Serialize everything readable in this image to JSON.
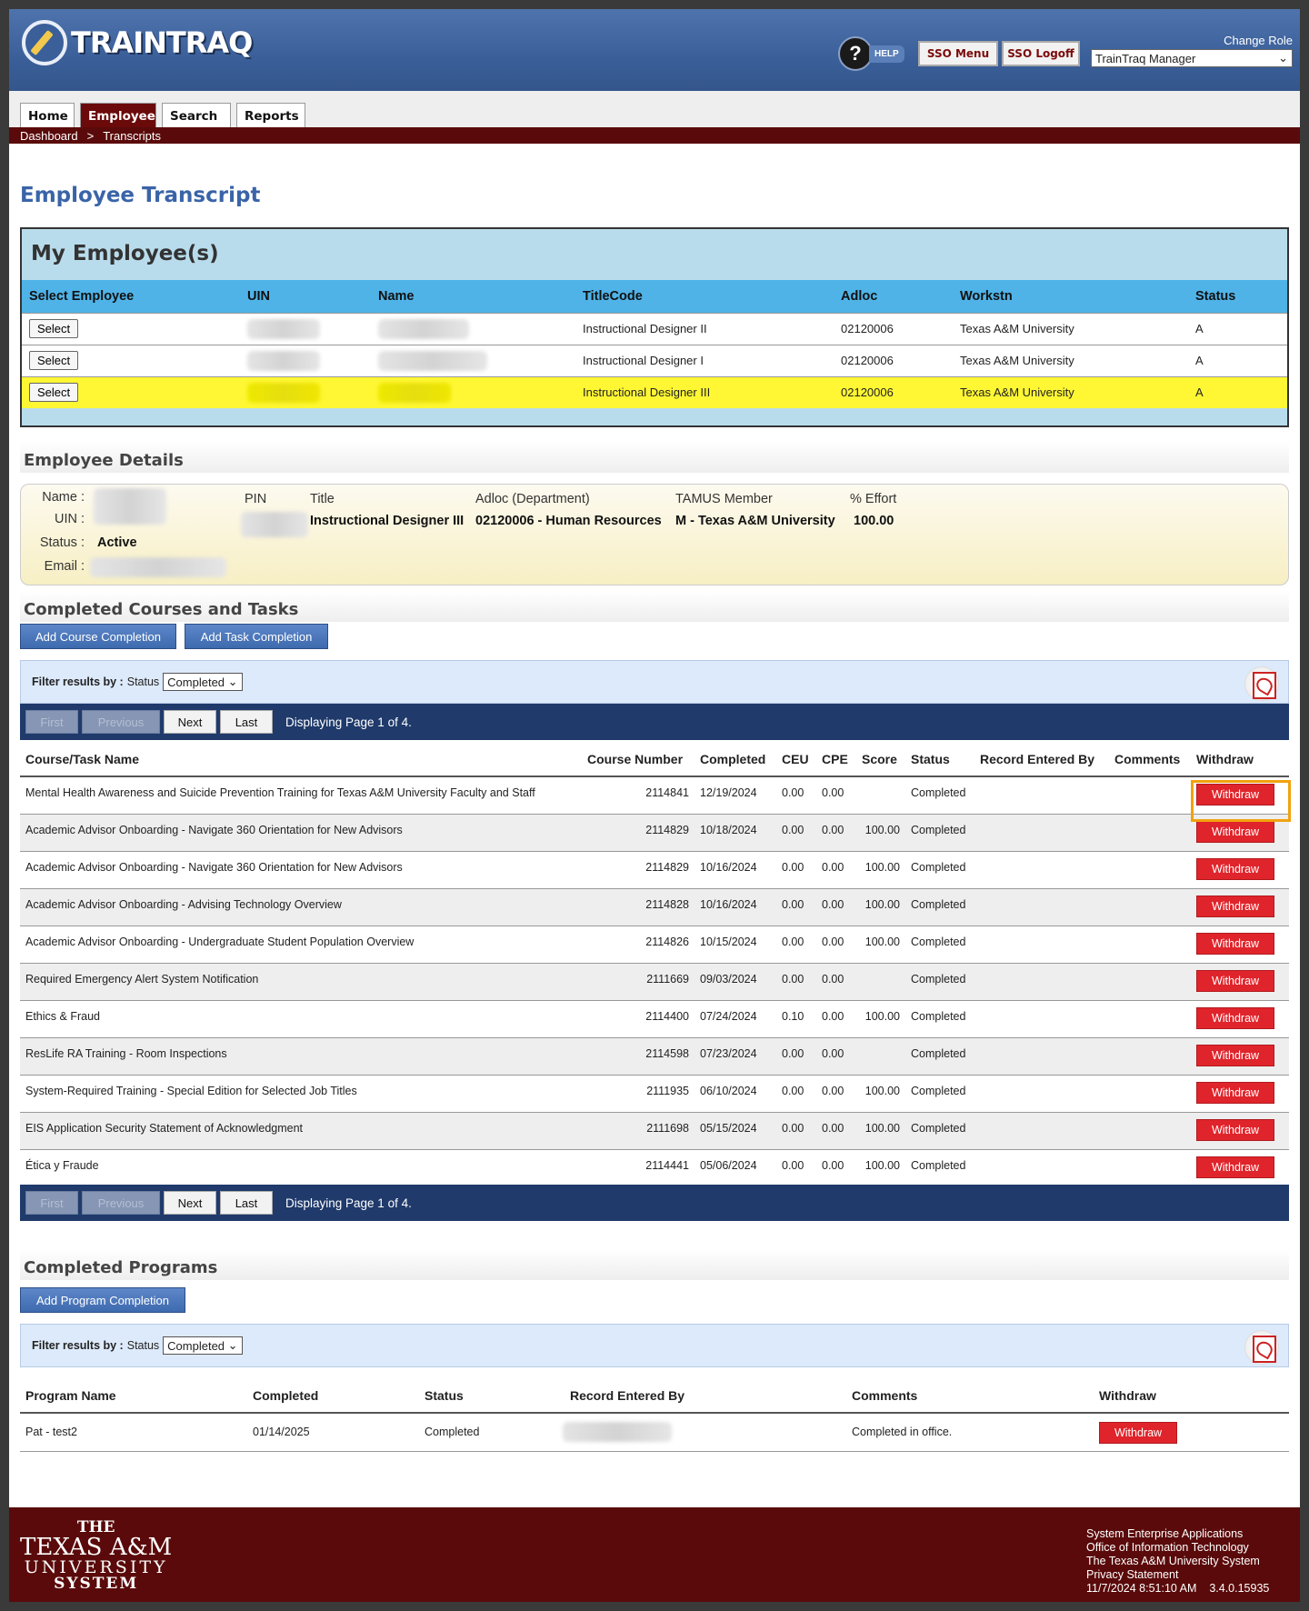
{
  "header": {
    "logo_text": "TRAINTRAQ",
    "help_label": "HELP",
    "sso_menu": "SSO Menu",
    "sso_logoff": "SSO Logoff",
    "change_role_label": "Change Role",
    "role_selected": "TrainTraq Manager"
  },
  "nav": {
    "tabs": [
      "Home",
      "Employee",
      "Search",
      "Reports"
    ],
    "active_tab": "Employee",
    "breadcrumb": [
      "Dashboard",
      ">",
      "Transcripts"
    ]
  },
  "page_title": "Employee Transcript",
  "my_employees": {
    "title": "My Employee(s)",
    "columns": [
      "Select Employee",
      "UIN",
      "Name",
      "TitleCode",
      "Adloc",
      "Workstn",
      "Status"
    ],
    "select_label": "Select",
    "rows": [
      {
        "title": "Instructional Designer II",
        "adloc": "02120006",
        "worksta": "Texas A&M University",
        "status": "A"
      },
      {
        "title": "Instructional Designer I",
        "adloc": "02120006",
        "worksta": "Texas A&M University",
        "status": "A"
      },
      {
        "title": "Instructional Designer III",
        "adloc": "02120006",
        "worksta": "Texas A&M University",
        "status": "A"
      }
    ]
  },
  "employee_details": {
    "section_title": "Employee Details",
    "name_label": "Name :",
    "uin_label": "UIN :",
    "status_label": "Status :",
    "status_value": "Active",
    "email_label": "Email :",
    "pin_label": "PIN",
    "title_label": "Title",
    "title_value": "Instructional Designer III",
    "adloc_label": "Adloc (Department)",
    "adloc_value": "02120006 - Human Resources",
    "member_label": "TAMUS Member",
    "member_value": "M - Texas A&M University",
    "effort_label": "% Effort",
    "effort_value": "100.00"
  },
  "completed_courses": {
    "section_title": "Completed Courses and Tasks",
    "add_course_label": "Add Course Completion",
    "add_task_label": "Add Task Completion",
    "filter_label": "Filter results by :",
    "filter_field": "Status",
    "filter_value": "Completed",
    "pager": {
      "first": "First",
      "previous": "Previous",
      "next": "Next",
      "last": "Last",
      "text": "Displaying Page 1 of 4."
    },
    "columns": [
      "Course/Task Name",
      "Course Number",
      "Completed",
      "CEU",
      "CPE",
      "Score",
      "Status",
      "Record Entered By",
      "Comments",
      "Withdraw"
    ],
    "withdraw_label": "Withdraw",
    "rows": [
      {
        "name": "Mental Health Awareness and Suicide Prevention Training for Texas A&M University Faculty and Staff",
        "number": "2114841",
        "completed": "12/19/2024",
        "ceu": "0.00",
        "cpe": "0.00",
        "score": "",
        "status": "Completed"
      },
      {
        "name": "Academic Advisor Onboarding - Navigate 360 Orientation for New Advisors",
        "number": "2114829",
        "completed": "10/18/2024",
        "ceu": "0.00",
        "cpe": "0.00",
        "score": "100.00",
        "status": "Completed"
      },
      {
        "name": "Academic Advisor Onboarding - Navigate 360 Orientation for New Advisors",
        "number": "2114829",
        "completed": "10/16/2024",
        "ceu": "0.00",
        "cpe": "0.00",
        "score": "100.00",
        "status": "Completed"
      },
      {
        "name": "Academic Advisor Onboarding - Advising Technology Overview",
        "number": "2114828",
        "completed": "10/16/2024",
        "ceu": "0.00",
        "cpe": "0.00",
        "score": "100.00",
        "status": "Completed"
      },
      {
        "name": "Academic Advisor Onboarding - Undergraduate Student Population Overview",
        "number": "2114826",
        "completed": "10/15/2024",
        "ceu": "0.00",
        "cpe": "0.00",
        "score": "100.00",
        "status": "Completed"
      },
      {
        "name": "Required Emergency Alert System Notification",
        "number": "2111669",
        "completed": "09/03/2024",
        "ceu": "0.00",
        "cpe": "0.00",
        "score": "",
        "status": "Completed"
      },
      {
        "name": "Ethics & Fraud",
        "number": "2114400",
        "completed": "07/24/2024",
        "ceu": "0.10",
        "cpe": "0.00",
        "score": "100.00",
        "status": "Completed"
      },
      {
        "name": "ResLife RA Training - Room Inspections",
        "number": "2114598",
        "completed": "07/23/2024",
        "ceu": "0.00",
        "cpe": "0.00",
        "score": "",
        "status": "Completed"
      },
      {
        "name": "System-Required Training - Special Edition for Selected Job Titles",
        "number": "2111935",
        "completed": "06/10/2024",
        "ceu": "0.00",
        "cpe": "0.00",
        "score": "100.00",
        "status": "Completed"
      },
      {
        "name": "EIS Application Security Statement of Acknowledgment",
        "number": "2111698",
        "completed": "05/15/2024",
        "ceu": "0.00",
        "cpe": "0.00",
        "score": "100.00",
        "status": "Completed"
      },
      {
        "name": "Ética y Fraude",
        "number": "2114441",
        "completed": "05/06/2024",
        "ceu": "0.00",
        "cpe": "0.00",
        "score": "100.00",
        "status": "Completed"
      }
    ]
  },
  "completed_programs": {
    "section_title": "Completed Programs",
    "add_program_label": "Add Program Completion",
    "filter_label": "Filter results by :",
    "filter_field": "Status",
    "filter_value": "Completed",
    "columns": [
      "Program Name",
      "Completed",
      "Status",
      "Record Entered By",
      "Comments",
      "Withdraw"
    ],
    "withdraw_label": "Withdraw",
    "rows": [
      {
        "name": "Pat - test2",
        "completed": "01/14/2025",
        "status": "Completed",
        "comments": "Completed in office."
      }
    ]
  },
  "footer": {
    "logo_lines": [
      "THE",
      "TEXAS A&M",
      "UNIVERSITY",
      "SYSTEM"
    ],
    "info_lines": [
      "System Enterprise Applications",
      "Office of Information Technology",
      "The Texas A&M University System",
      "Privacy Statement"
    ],
    "timestamp": "11/7/2024 8:51:10 AM",
    "version": "3.4.0.15935"
  },
  "colors": {
    "brand_maroon": "#5a0a0a",
    "header_blue": "#3a5f99",
    "withdraw_red": "#e0242b",
    "highlight_yellow": "#fff733",
    "focus_orange": "#f2a20e"
  }
}
